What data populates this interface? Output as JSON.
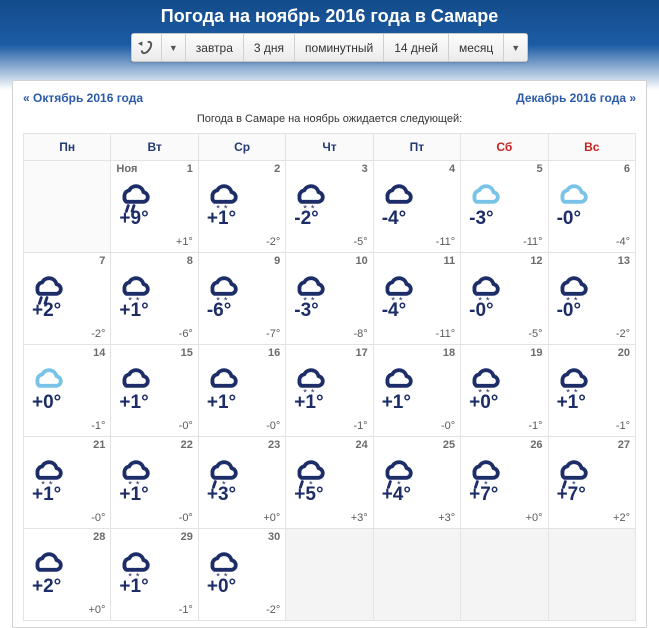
{
  "header": {
    "title": "Погода на ноябрь 2016 года в Самаре"
  },
  "toolbar": {
    "tabs": [
      "завтра",
      "3 дня",
      "поминутный",
      "14 дней",
      "месяц"
    ]
  },
  "nav": {
    "prev_label": "« Октябрь 2016 года",
    "next_label": "Декабрь 2016 года »"
  },
  "subtitle": "Погода в Самаре на ноябрь ожидается следующей:",
  "dow": [
    "Пн",
    "Вт",
    "Ср",
    "Чт",
    "Пт",
    "Сб",
    "Вс"
  ],
  "month_label": "Ноя",
  "cells": [
    {
      "empty": true
    },
    {
      "day": 1,
      "month_first": true,
      "icon": "rain",
      "hi": "+9°",
      "lo": "+1°"
    },
    {
      "day": 2,
      "icon": "snow",
      "hi": "+1°",
      "lo": "-2°"
    },
    {
      "day": 3,
      "icon": "snow",
      "hi": "-2°",
      "lo": "-5°"
    },
    {
      "day": 4,
      "icon": "cloud",
      "hi": "-4°",
      "lo": "-11°"
    },
    {
      "day": 5,
      "icon": "cloud-lt",
      "hi": "-3°",
      "lo": "-11°"
    },
    {
      "day": 6,
      "icon": "cloud-lt",
      "hi": "-0°",
      "lo": "-4°"
    },
    {
      "day": 7,
      "icon": "rain",
      "hi": "+2°",
      "lo": "-2°"
    },
    {
      "day": 8,
      "icon": "snow",
      "hi": "+1°",
      "lo": "-6°"
    },
    {
      "day": 9,
      "icon": "snow",
      "hi": "-6°",
      "lo": "-7°"
    },
    {
      "day": 10,
      "icon": "snow",
      "hi": "-3°",
      "lo": "-8°"
    },
    {
      "day": 11,
      "icon": "snow",
      "hi": "-4°",
      "lo": "-11°"
    },
    {
      "day": 12,
      "icon": "snow",
      "hi": "-0°",
      "lo": "-5°"
    },
    {
      "day": 13,
      "icon": "snow",
      "hi": "-0°",
      "lo": "-2°"
    },
    {
      "day": 14,
      "icon": "cloud-lt",
      "hi": "+0°",
      "lo": "-1°"
    },
    {
      "day": 15,
      "icon": "cloud",
      "hi": "+1°",
      "lo": "-0°"
    },
    {
      "day": 16,
      "icon": "cloud",
      "hi": "+1°",
      "lo": "-0°"
    },
    {
      "day": 17,
      "icon": "snow",
      "hi": "+1°",
      "lo": "-1°"
    },
    {
      "day": 18,
      "icon": "cloud",
      "hi": "+1°",
      "lo": "-0°"
    },
    {
      "day": 19,
      "icon": "snow",
      "hi": "+0°",
      "lo": "-1°"
    },
    {
      "day": 20,
      "icon": "snow",
      "hi": "+1°",
      "lo": "-1°"
    },
    {
      "day": 21,
      "icon": "snow",
      "hi": "+1°",
      "lo": "-0°"
    },
    {
      "day": 22,
      "icon": "snow",
      "hi": "+1°",
      "lo": "-0°"
    },
    {
      "day": 23,
      "icon": "rainmix",
      "hi": "+3°",
      "lo": "+0°"
    },
    {
      "day": 24,
      "icon": "rainmix",
      "hi": "+5°",
      "lo": "+3°"
    },
    {
      "day": 25,
      "icon": "rainmix",
      "hi": "+4°",
      "lo": "+3°"
    },
    {
      "day": 26,
      "icon": "rainmix",
      "hi": "+7°",
      "lo": "+0°"
    },
    {
      "day": 27,
      "icon": "rainmix",
      "hi": "+7°",
      "lo": "+2°"
    },
    {
      "day": 28,
      "icon": "cloud",
      "hi": "+2°",
      "lo": "+0°"
    },
    {
      "day": 29,
      "icon": "snow",
      "hi": "+1°",
      "lo": "-1°"
    },
    {
      "day": 30,
      "icon": "snow",
      "hi": "+0°",
      "lo": "-2°"
    },
    {
      "empty": true
    },
    {
      "empty": true
    },
    {
      "empty": true
    },
    {
      "empty": true
    }
  ]
}
